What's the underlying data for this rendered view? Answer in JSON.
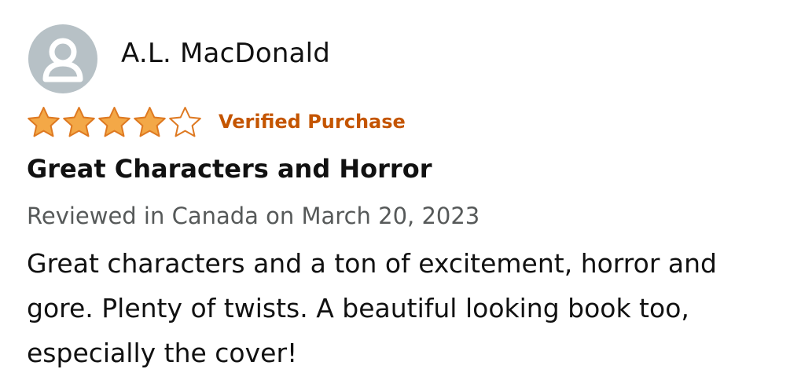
{
  "reviewer": {
    "name": "A.L. MacDonald",
    "avatar_icon": "user-silhouette-icon"
  },
  "rating": {
    "stars_filled": 4,
    "stars_total": 5,
    "star_color": "#f3a847",
    "star_outline_color": "#de7921",
    "verified_label": "Verified Purchase",
    "verified_color": "#c45500"
  },
  "review": {
    "title": "Great Characters and Horror",
    "meta": "Reviewed in Canada on March 20, 2023",
    "body": "Great characters and a ton of excitement, horror and gore. Plenty of twists. A beautiful looking book too, especially the cover!"
  }
}
